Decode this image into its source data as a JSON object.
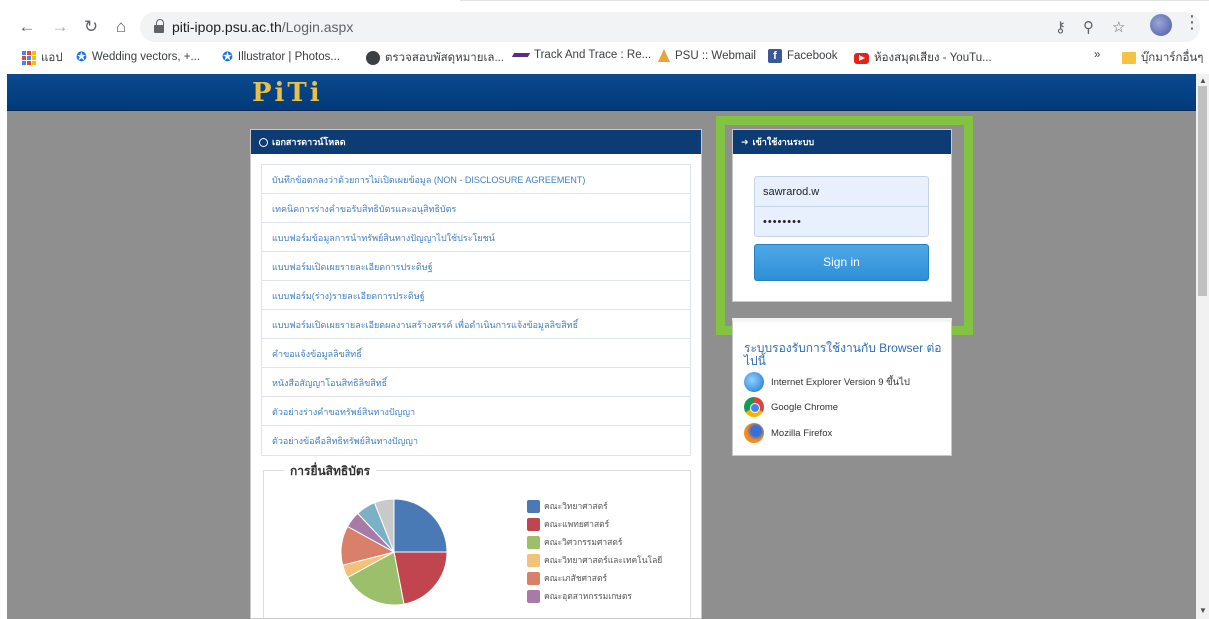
{
  "browser": {
    "url_host": "piti-ipop.psu.ac.th",
    "url_path": "/Login.aspx",
    "bookmarks": [
      {
        "label": "แอป",
        "icon": "apps-icon"
      },
      {
        "label": "Wedding vectors, +...",
        "icon": "bookmark-star-icon"
      },
      {
        "label": "Illustrator | Photos...",
        "icon": "bookmark-star-icon"
      },
      {
        "label": "ตรวจสอบพัสดุหมายเล...",
        "icon": "globe-icon"
      },
      {
        "label": "Track And Trace : Re...",
        "icon": "track-icon"
      },
      {
        "label": "PSU :: Webmail",
        "icon": "psu-icon"
      },
      {
        "label": "Facebook",
        "icon": "facebook-icon"
      },
      {
        "label": "ห้องสมุดเสียง - YouTu...",
        "icon": "youtube-icon"
      }
    ],
    "overflow": "»",
    "other_bookmarks": "บุ๊กมาร์กอื่นๆ"
  },
  "site": {
    "logo": "PiTi"
  },
  "downloads": {
    "title": "เอกสารดาวน์โหลด",
    "items": [
      "บันทึกข้อตกลงว่าด้วยการไม่เปิดเผยข้อมูล (NON - DISCLOSURE AGREEMENT)",
      "เทคนิคการร่างคำขอรับสิทธิบัตรและอนุสิทธิบัตร",
      "แบบฟอร์มข้อมูลการนำทรัพย์สินทางปัญญาไปใช้ประโยชน์",
      "แบบฟอร์มเปิดเผยรายละเอียดการประดิษฐ์",
      "แบบฟอร์ม(ร่าง)รายละเอียดการประดิษฐ์",
      "แบบฟอร์มเปิดเผยรายละเอียดผลงานสร้างสรรค์ เพื่อดำเนินการแจ้งข้อมูลลิขสิทธิ์",
      "คำขอแจ้งข้อมูลลิขสิทธิ์",
      "หนังสือสัญญาโอนสิทธิลิขสิทธิ์",
      "ตัวอย่างร่างคำขอทรัพย์สินทางปัญญา",
      "ตัวอย่างข้อคือสิทธิทรัพย์สินทางปัญญา"
    ]
  },
  "chart_data": {
    "type": "pie",
    "title": "การยื่นสิทธิบัตร",
    "categories": [
      "คณะวิทยาศาสตร์",
      "คณะแพทยศาสตร์",
      "คณะวิศวกรรมศาสตร์",
      "คณะวิทยาศาสตร์และเทคโนโลยี",
      "คณะเภสัชศาสตร์",
      "คณะอุตสาหกรรมเกษตร",
      "",
      ""
    ],
    "values": [
      25,
      22,
      20,
      4,
      12,
      5,
      6,
      6
    ],
    "colors": [
      "#4a7ab5",
      "#c0454f",
      "#9bbf6a",
      "#f0c27a",
      "#d9806a",
      "#a87aa8",
      "#7bb0c6",
      "#c9c9c9"
    ],
    "legend": "right"
  },
  "login": {
    "title": "เข้าใช้งานระบบ",
    "username_value": "sawrarod.w",
    "password_mask": "••••••••",
    "signin_label": "Sign in"
  },
  "support": {
    "title": "ระบบรองรับการใช้งานกับ Browser ต่อไปนี้",
    "browsers": [
      {
        "label": "Internet Explorer Version 9 ขึ้นไป",
        "icon": "internet-explorer-icon"
      },
      {
        "label": "Google Chrome",
        "icon": "google-chrome-icon"
      },
      {
        "label": "Mozilla Firefox",
        "icon": "firefox-icon"
      }
    ]
  }
}
